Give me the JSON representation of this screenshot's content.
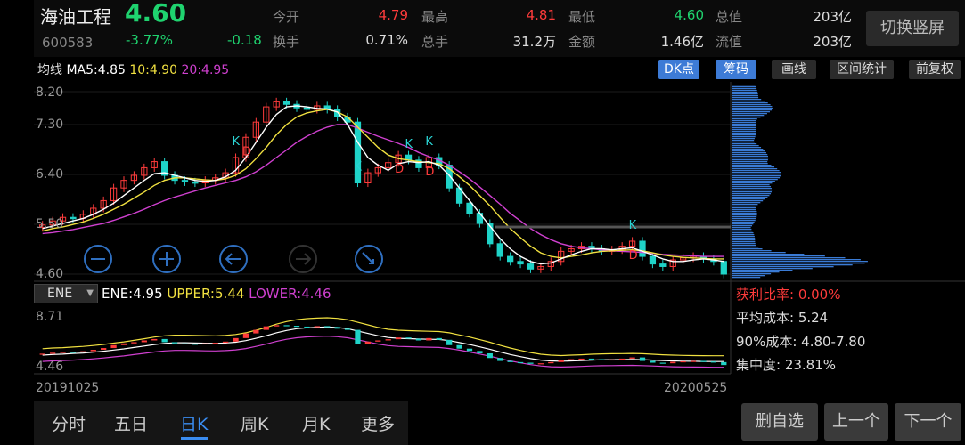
{
  "quote": {
    "name": "海油工程",
    "price": "4.60",
    "code": "600583",
    "change_pct": "-3.77%",
    "change": "-0.18",
    "stats": [
      {
        "label": "今开",
        "value": "4.79",
        "color": "#ff3b3b"
      },
      {
        "label": "最高",
        "value": "4.81",
        "color": "#ff3b3b"
      },
      {
        "label": "最低",
        "value": "4.60",
        "color": "#1fd36f"
      },
      {
        "label": "总值",
        "value": "203亿",
        "color": "#dddddd"
      },
      {
        "label": "换手",
        "value": "0.71%",
        "color": "#dddddd"
      },
      {
        "label": "总手",
        "value": "31.2万",
        "color": "#dddddd"
      },
      {
        "label": "金额",
        "value": "1.46亿",
        "color": "#dddddd"
      },
      {
        "label": "流值",
        "value": "203亿",
        "color": "#dddddd"
      }
    ],
    "switch_label": "切换竖屏"
  },
  "ma": {
    "label": "均线",
    "ma5": "MA5:4.85",
    "ma10": "10:4.90",
    "ma20": "20:4.95",
    "buttons": [
      "DK点",
      "筹码",
      "画线",
      "区间统计",
      "前复权"
    ]
  },
  "price_axis": [
    "8.20",
    "7.30",
    "6.40",
    "5.50",
    "4.60"
  ],
  "indicator": {
    "selector": "ENE",
    "ene": "ENE:4.95",
    "upper": "UPPER:5.44",
    "lower": "LOWER:4.46",
    "axis_top": "8.71",
    "axis_bottom": "4.46"
  },
  "dates": {
    "start": "20191025",
    "end": "20200525"
  },
  "chips": {
    "profit_ratio": "获利比率: 0.00%",
    "avg_cost": "平均成本: 5.24",
    "cost_90": "90%成本: 4.80-7.80",
    "concentration": "集中度: 23.81%"
  },
  "tabs": [
    "分时",
    "五日",
    "日K",
    "周K",
    "月K",
    "更多"
  ],
  "active_tab": "日K",
  "actions": {
    "remove": "删自选",
    "prev": "上一个",
    "next": "下一个"
  },
  "marks": {
    "k": "K",
    "d": "D"
  },
  "colors": {
    "up": "#ff3b3b",
    "down": "#1fd36f",
    "ma5": "#ffffff",
    "ma10": "#f0e040",
    "ma20": "#d040d0",
    "chip": "#3a7bd5"
  },
  "chart_data": {
    "type": "candlestick",
    "y_range": [
      4.6,
      8.2
    ],
    "close": [
      5.57,
      5.65,
      5.72,
      5.7,
      5.78,
      5.9,
      6.05,
      6.3,
      6.45,
      6.55,
      6.7,
      6.82,
      6.55,
      6.45,
      6.42,
      6.4,
      6.45,
      6.5,
      6.6,
      6.9,
      7.3,
      7.6,
      7.9,
      8.0,
      7.95,
      7.88,
      7.85,
      7.92,
      7.85,
      7.7,
      7.6,
      6.4,
      6.6,
      6.7,
      6.8,
      6.95,
      6.85,
      6.7,
      6.9,
      6.75,
      6.3,
      6.0,
      5.8,
      5.6,
      5.2,
      4.95,
      4.85,
      4.8,
      4.7,
      4.75,
      4.85,
      5.05,
      5.1,
      5.15,
      5.1,
      5.05,
      5.08,
      5.15,
      5.25,
      4.95,
      4.8,
      4.75,
      4.88,
      4.92,
      4.95,
      4.9,
      4.85,
      4.6
    ],
    "ma5": [
      5.5,
      5.55,
      5.6,
      5.65,
      5.7,
      5.78,
      5.88,
      6.0,
      6.15,
      6.3,
      6.45,
      6.58,
      6.6,
      6.55,
      6.5,
      6.45,
      6.43,
      6.45,
      6.52,
      6.65,
      6.9,
      7.2,
      7.5,
      7.75,
      7.9,
      7.92,
      7.9,
      7.87,
      7.86,
      7.8,
      7.55,
      7.2,
      6.9,
      6.75,
      6.65,
      6.78,
      6.82,
      6.8,
      6.82,
      6.75,
      6.55,
      6.3,
      6.05,
      5.8,
      5.55,
      5.3,
      5.1,
      4.95,
      4.85,
      4.8,
      4.82,
      4.9,
      4.98,
      5.05,
      5.1,
      5.1,
      5.08,
      5.1,
      5.12,
      5.05,
      4.98,
      4.9,
      4.85,
      4.85,
      4.88,
      4.9,
      4.88,
      4.85
    ],
    "ma10": [
      5.45,
      5.5,
      5.53,
      5.58,
      5.63,
      5.7,
      5.78,
      5.88,
      5.98,
      6.1,
      6.22,
      6.35,
      6.45,
      6.5,
      6.5,
      6.48,
      6.46,
      6.45,
      6.48,
      6.55,
      6.68,
      6.88,
      7.1,
      7.35,
      7.55,
      7.7,
      7.78,
      7.82,
      7.85,
      7.8,
      7.7,
      7.5,
      7.3,
      7.1,
      6.95,
      6.88,
      6.85,
      6.82,
      6.8,
      6.78,
      6.68,
      6.52,
      6.35,
      6.15,
      5.95,
      5.72,
      5.5,
      5.32,
      5.15,
      5.02,
      4.95,
      4.92,
      4.95,
      4.98,
      5.02,
      5.05,
      5.06,
      5.07,
      5.08,
      5.06,
      5.02,
      4.98,
      4.95,
      4.93,
      4.92,
      4.91,
      4.9,
      4.9
    ],
    "ma20": [
      5.4,
      5.42,
      5.45,
      5.48,
      5.52,
      5.56,
      5.6,
      5.66,
      5.73,
      5.8,
      5.88,
      5.97,
      6.05,
      6.12,
      6.18,
      6.24,
      6.3,
      6.35,
      6.4,
      6.45,
      6.52,
      6.62,
      6.75,
      6.9,
      7.05,
      7.2,
      7.32,
      7.42,
      7.5,
      7.55,
      7.55,
      7.48,
      7.4,
      7.32,
      7.25,
      7.18,
      7.1,
      7.0,
      6.92,
      6.85,
      6.75,
      6.62,
      6.48,
      6.32,
      6.15,
      5.98,
      5.8,
      5.65,
      5.5,
      5.38,
      5.28,
      5.2,
      5.15,
      5.12,
      5.1,
      5.08,
      5.06,
      5.05,
      5.04,
      5.03,
      5.01,
      4.99,
      4.98,
      4.97,
      4.96,
      4.95,
      4.95,
      4.95
    ]
  }
}
